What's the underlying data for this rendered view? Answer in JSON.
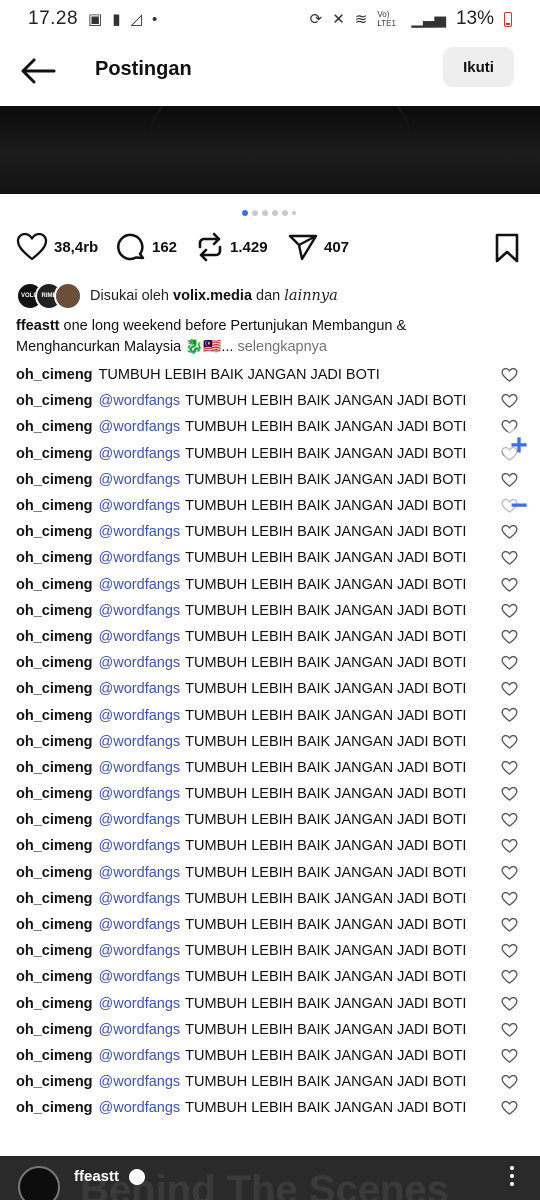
{
  "status_bar": {
    "time": "17.28",
    "battery": "13%",
    "network_label": "Vo) LTE1",
    "left_icons": [
      "gallery-icon",
      "alert-icon",
      "signal-off-icon",
      "dot-icon"
    ],
    "right_icons": [
      "sync-icon",
      "mute-icon",
      "wifi-icon",
      "volte-icon",
      "signal-icon",
      "battery-icon"
    ]
  },
  "header": {
    "title": "Postingan",
    "follow_label": "Ikuti"
  },
  "carousel": {
    "count": 6,
    "active": 1
  },
  "actions": {
    "likes": "38,4rb",
    "comments": "162",
    "reposts": "1.429",
    "shares": "407"
  },
  "liked_by": {
    "prefix": "Disukai oleh",
    "user": "volix.media",
    "joiner": "dan",
    "others": "lainnya",
    "avatar_labels": [
      "VOLIX",
      "RIME"
    ]
  },
  "caption": {
    "user": "ffeastt",
    "text": "one long weekend before Pertunjukan Membangun & Menghancurkan Malaysia 🐉🇲🇾...",
    "more": "selengkapnya"
  },
  "comments": [
    {
      "user": "oh_cimeng",
      "mention": "",
      "text": "TUMBUH LEBIH BAIK JANGAN JADI BOTI"
    },
    {
      "user": "oh_cimeng",
      "mention": "@wordfangs",
      "text": "TUMBUH LEBIH BAIK JANGAN JADI BOTI"
    },
    {
      "user": "oh_cimeng",
      "mention": "@wordfangs",
      "text": "TUMBUH LEBIH BAIK JANGAN JADI BOTI"
    },
    {
      "user": "oh_cimeng",
      "mention": "@wordfangs",
      "text": "TUMBUH LEBIH BAIK JANGAN JADI BOTI"
    },
    {
      "user": "oh_cimeng",
      "mention": "@wordfangs",
      "text": "TUMBUH LEBIH BAIK JANGAN JADI BOTI"
    },
    {
      "user": "oh_cimeng",
      "mention": "@wordfangs",
      "text": "TUMBUH LEBIH BAIK JANGAN JADI BOTI"
    },
    {
      "user": "oh_cimeng",
      "mention": "@wordfangs",
      "text": "TUMBUH LEBIH BAIK JANGAN JADI BOTI"
    },
    {
      "user": "oh_cimeng",
      "mention": "@wordfangs",
      "text": "TUMBUH LEBIH BAIK JANGAN JADI BOTI"
    },
    {
      "user": "oh_cimeng",
      "mention": "@wordfangs",
      "text": "TUMBUH LEBIH BAIK JANGAN JADI BOTI"
    },
    {
      "user": "oh_cimeng",
      "mention": "@wordfangs",
      "text": "TUMBUH LEBIH BAIK JANGAN JADI BOTI"
    },
    {
      "user": "oh_cimeng",
      "mention": "@wordfangs",
      "text": "TUMBUH LEBIH BAIK JANGAN JADI BOTI"
    },
    {
      "user": "oh_cimeng",
      "mention": "@wordfangs",
      "text": "TUMBUH LEBIH BAIK JANGAN JADI BOTI"
    },
    {
      "user": "oh_cimeng",
      "mention": "@wordfangs",
      "text": "TUMBUH LEBIH BAIK JANGAN JADI BOTI"
    },
    {
      "user": "oh_cimeng",
      "mention": "@wordfangs",
      "text": "TUMBUH LEBIH BAIK JANGAN JADI BOTI"
    },
    {
      "user": "oh_cimeng",
      "mention": "@wordfangs",
      "text": "TUMBUH LEBIH BAIK JANGAN JADI BOTI"
    },
    {
      "user": "oh_cimeng",
      "mention": "@wordfangs",
      "text": "TUMBUH LEBIH BAIK JANGAN JADI BOTI"
    },
    {
      "user": "oh_cimeng",
      "mention": "@wordfangs",
      "text": "TUMBUH LEBIH BAIK JANGAN JADI BOTI"
    },
    {
      "user": "oh_cimeng",
      "mention": "@wordfangs",
      "text": "TUMBUH LEBIH BAIK JANGAN JADI BOTI"
    },
    {
      "user": "oh_cimeng",
      "mention": "@wordfangs",
      "text": "TUMBUH LEBIH BAIK JANGAN JADI BOTI"
    },
    {
      "user": "oh_cimeng",
      "mention": "@wordfangs",
      "text": "TUMBUH LEBIH BAIK JANGAN JADI BOTI"
    },
    {
      "user": "oh_cimeng",
      "mention": "@wordfangs",
      "text": "TUMBUH LEBIH BAIK JANGAN JADI BOTI"
    },
    {
      "user": "oh_cimeng",
      "mention": "@wordfangs",
      "text": "TUMBUH LEBIH BAIK JANGAN JADI BOTI"
    },
    {
      "user": "oh_cimeng",
      "mention": "@wordfangs",
      "text": "TUMBUH LEBIH BAIK JANGAN JADI BOTI"
    },
    {
      "user": "oh_cimeng",
      "mention": "@wordfangs",
      "text": "TUMBUH LEBIH BAIK JANGAN JADI BOTI"
    },
    {
      "user": "oh_cimeng",
      "mention": "@wordfangs",
      "text": "TUMBUH LEBIH BAIK JANGAN JADI BOTI"
    },
    {
      "user": "oh_cimeng",
      "mention": "@wordfangs",
      "text": "TUMBUH LEBIH BAIK JANGAN JADI BOTI"
    },
    {
      "user": "oh_cimeng",
      "mention": "@wordfangs",
      "text": "TUMBUH LEBIH BAIK JANGAN JADI BOTI"
    },
    {
      "user": "oh_cimeng",
      "mention": "@wordfangs",
      "text": "TUMBUH LEBIH BAIK JANGAN JADI BOTI"
    },
    {
      "user": "oh_cimeng",
      "mention": "@wordfangs",
      "text": "TUMBUH LEBIH BAIK JANGAN JADI BOTI"
    }
  ],
  "zoom": {
    "plus": "+",
    "minus": "−"
  },
  "next_post": {
    "user": "ffeastt",
    "background_text": "Behind The Scenes"
  },
  "colors": {
    "mention": "#3a53b8",
    "carousel_active": "#3b6cf5",
    "muted": "#737373",
    "follow_button_bg": "#eeeeef",
    "battery_low": "#e0302a"
  }
}
